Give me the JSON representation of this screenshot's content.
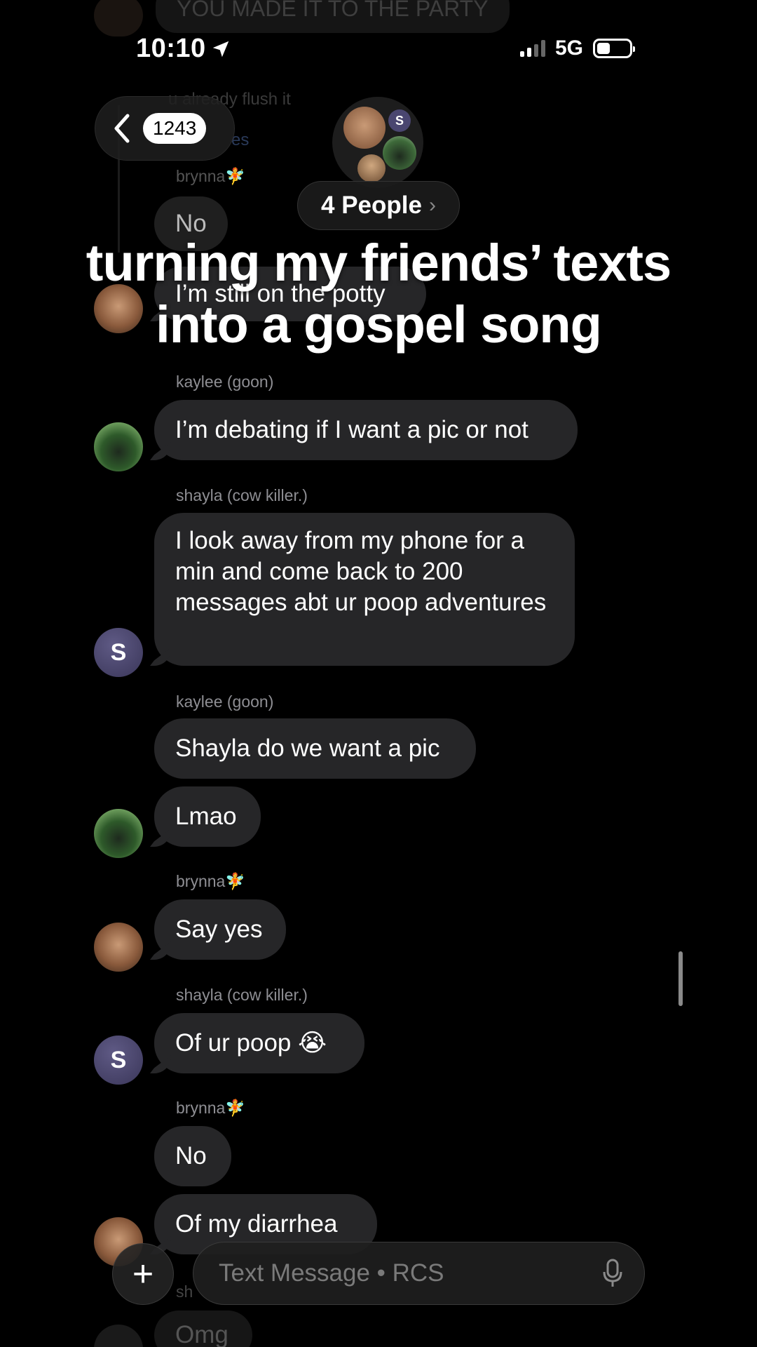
{
  "status_bar": {
    "time": "10:10",
    "network": "5G"
  },
  "header": {
    "unread_count": "1243",
    "people_label": "4 People",
    "group_avatar_badge": "S"
  },
  "background_faded": {
    "top_text": "YOU MADE IT TO THE PARTY",
    "line2": "u already flush it",
    "line3": "es"
  },
  "caption": {
    "line1": "turning my friends’ texts",
    "line2": "into a gospel song"
  },
  "messages": [
    {
      "sender": "brynna🧚",
      "text": "No"
    },
    {
      "sender": "",
      "text": "I’m still on the potty"
    },
    {
      "sender": "kaylee (goon)",
      "text": "I’m debating if I want a pic or not"
    },
    {
      "sender": "shayla (cow killer.)",
      "text": "I look away from my phone for a min and come back to 200 messages abt ur poop adventures"
    },
    {
      "sender": "kaylee (goon)",
      "text": "Shayla do we want a pic"
    },
    {
      "sender": "",
      "text": "Lmao"
    },
    {
      "sender": "brynna🧚",
      "text": "Say yes"
    },
    {
      "sender": "shayla (cow killer.)",
      "text": "Of ur poop 😭"
    },
    {
      "sender": "brynna🧚",
      "text": "No"
    },
    {
      "sender": "",
      "text": "Of my diarrhea"
    },
    {
      "sender": "sh",
      "text": "Omg"
    }
  ],
  "avatars": {
    "shayla_initial": "S"
  },
  "composer": {
    "plus_label": "+",
    "placeholder": "Text Message • RCS",
    "mic_icon": "microphone-icon"
  }
}
